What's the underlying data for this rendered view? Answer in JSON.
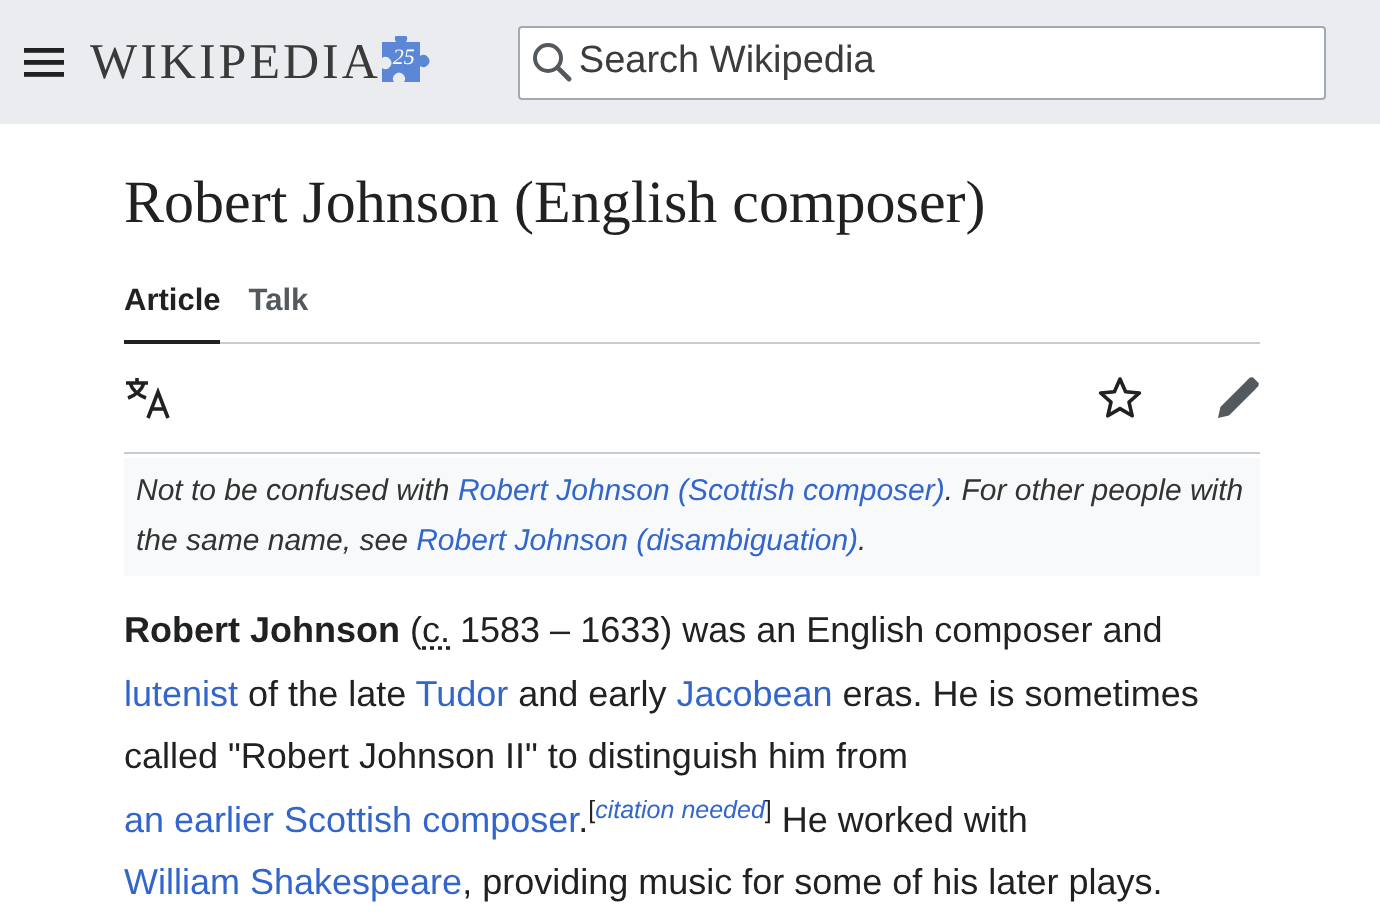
{
  "header": {
    "wordmark": "WIKIPEDIA",
    "logo_badge": "25",
    "search": {
      "placeholder": "Search Wikipedia"
    }
  },
  "article": {
    "title": "Robert Johnson (English composer)",
    "tabs": [
      {
        "label": "Article",
        "selected": true
      },
      {
        "label": "Talk",
        "selected": false
      }
    ],
    "hatnote": [
      {
        "kind": "text",
        "text": "Not to be confused with "
      },
      {
        "kind": "link",
        "text": "Robert Johnson (Scottish composer)"
      },
      {
        "kind": "text",
        "text": ". For other people with the same name, see "
      },
      {
        "kind": "link",
        "text": "Robert Johnson (disambiguation)"
      },
      {
        "kind": "text",
        "text": "."
      }
    ],
    "paragraph": [
      {
        "kind": "bold",
        "text": "Robert Johnson"
      },
      {
        "kind": "text",
        "text": " ("
      },
      {
        "kind": "abbr",
        "text": "c."
      },
      {
        "kind": "text",
        "text": " 1583 – 1633) was an English composer and "
      },
      {
        "kind": "link",
        "text": "lutenist"
      },
      {
        "kind": "text",
        "text": " of the late "
      },
      {
        "kind": "link",
        "text": "Tudor"
      },
      {
        "kind": "text",
        "text": " and early "
      },
      {
        "kind": "link",
        "text": "Jacobean"
      },
      {
        "kind": "text",
        "text": " eras. He is sometimes called \"Robert Johnson II\" to distinguish him from "
      },
      {
        "kind": "link",
        "text": "an earlier Scottish composer"
      },
      {
        "kind": "text",
        "text": "."
      },
      {
        "kind": "sup",
        "text": "["
      },
      {
        "kind": "sup-link",
        "text": "citation needed"
      },
      {
        "kind": "sup",
        "text": "]"
      },
      {
        "kind": "text",
        "text": " He worked with "
      },
      {
        "kind": "link",
        "text": "William Shakespeare"
      },
      {
        "kind": "text",
        "text": ", providing music for some of his later plays."
      }
    ]
  }
}
